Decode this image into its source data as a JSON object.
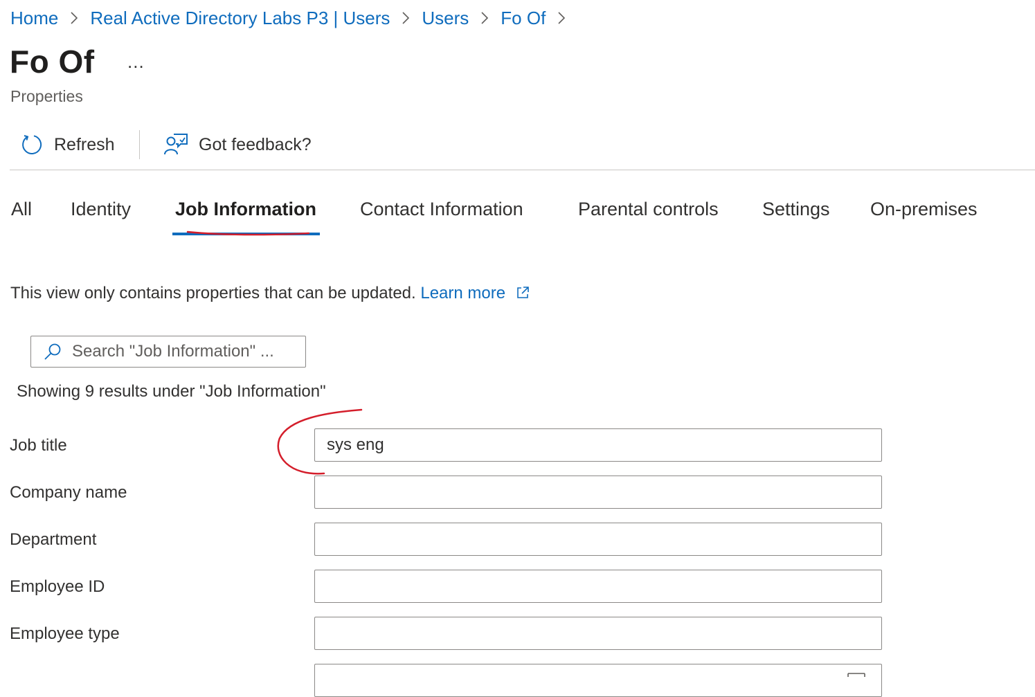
{
  "breadcrumb": {
    "items": [
      "Home",
      "Real Active Directory Labs P3 | Users",
      "Users",
      "Fo Of"
    ]
  },
  "header": {
    "title": "Fo Of",
    "more_label": "...",
    "subtitle": "Properties"
  },
  "toolbar": {
    "refresh_label": "Refresh",
    "feedback_label": "Got feedback?"
  },
  "tabs": [
    {
      "label": "All",
      "active": false
    },
    {
      "label": "Identity",
      "active": false
    },
    {
      "label": "Job Information",
      "active": true
    },
    {
      "label": "Contact Information",
      "active": false
    },
    {
      "label": "Parental controls",
      "active": false
    },
    {
      "label": "Settings",
      "active": false
    },
    {
      "label": "On-premises",
      "active": false
    }
  ],
  "info": {
    "text": "This view only contains properties that can be updated.",
    "link_label": "Learn more"
  },
  "search": {
    "placeholder": "Search \"Job Information\" ...",
    "value": ""
  },
  "results_text": "Showing 9 results under \"Job Information\"",
  "fields": [
    {
      "label": "Job title",
      "value": "sys eng"
    },
    {
      "label": "Company name",
      "value": ""
    },
    {
      "label": "Department",
      "value": ""
    },
    {
      "label": "Employee ID",
      "value": ""
    },
    {
      "label": "Employee type",
      "value": ""
    }
  ],
  "colors": {
    "link": "#0f6cbd",
    "annotation": "#d41e2b",
    "border": "#8a8886"
  },
  "icons": [
    "chevron-right-icon",
    "refresh-icon",
    "feedback-icon",
    "external-link-icon",
    "search-icon",
    "calendar-icon"
  ]
}
